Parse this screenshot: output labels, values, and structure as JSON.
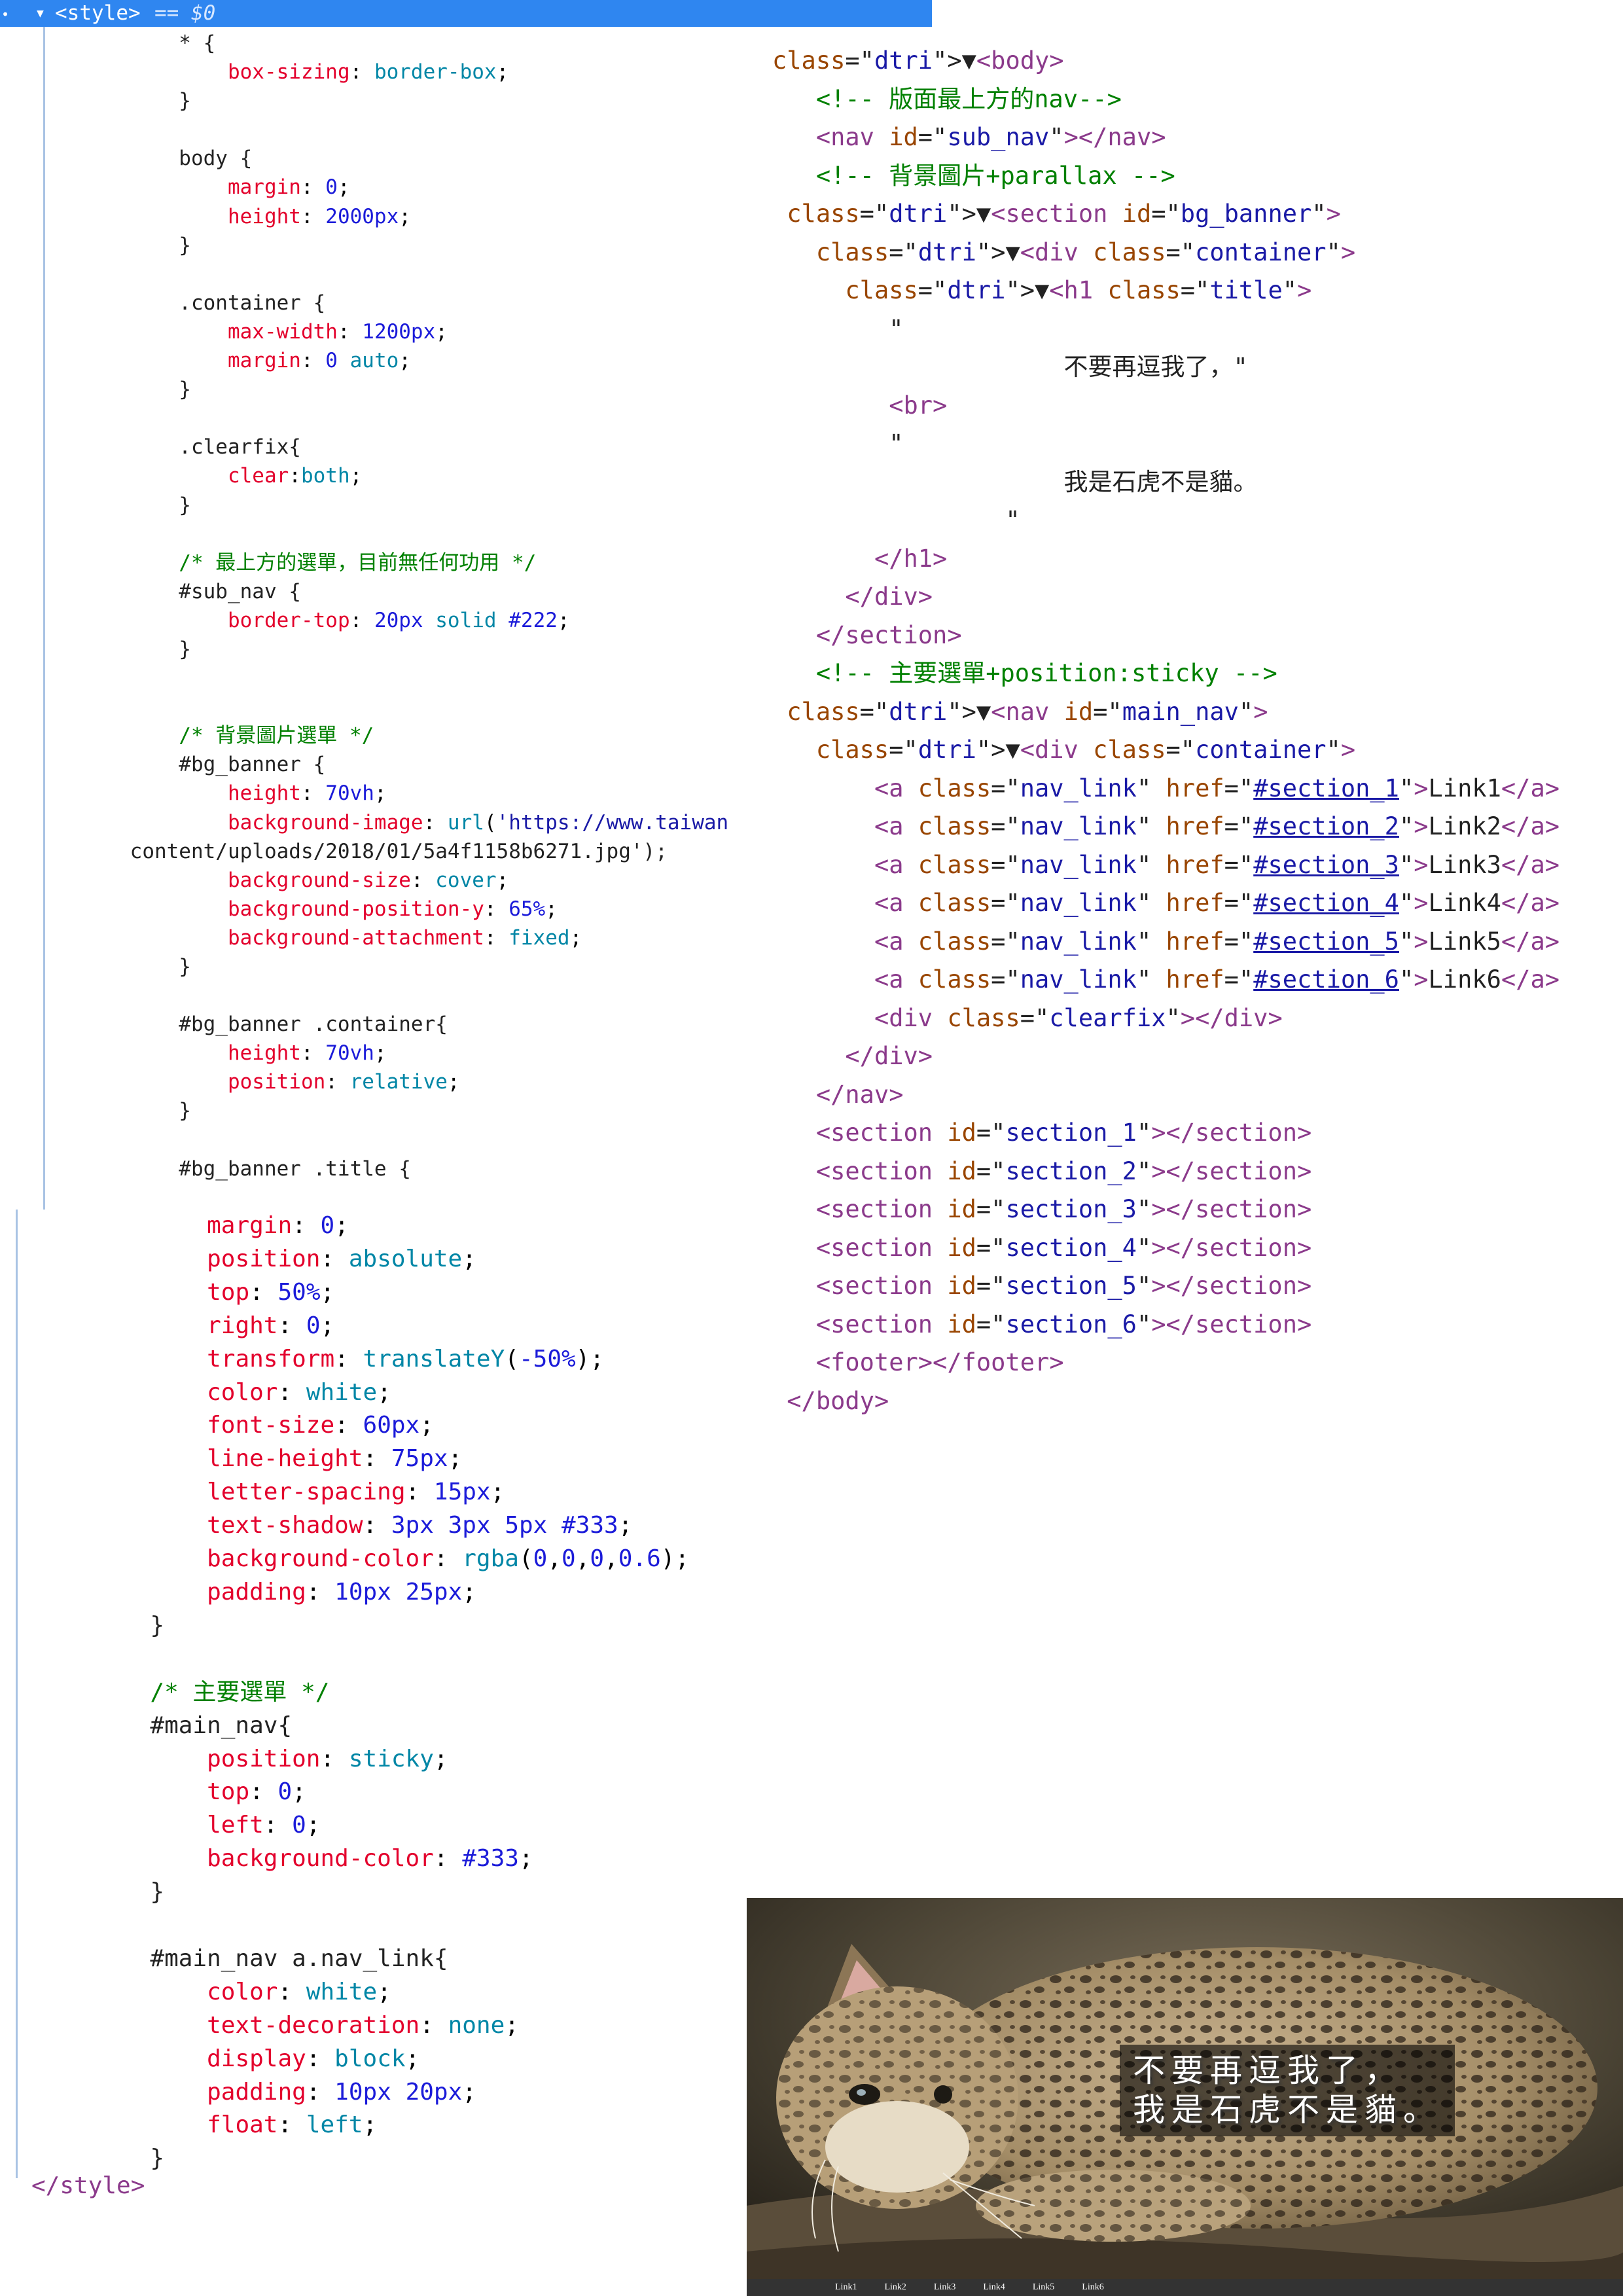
{
  "devtools_header": {
    "dot": "•",
    "expand_arrow": "▼",
    "tag_label": "<style>",
    "eq_label": "== $0"
  },
  "css_code": {
    "part1": "        * {\n            box-sizing: border-box;\n        }\n\n        body {\n            margin: 0;\n            height: 2000px;\n        }\n\n        .container {\n            max-width: 1200px;\n            margin: 0 auto;\n        }\n\n        .clearfix{\n            clear:both;\n        }\n\n        /* 最上方的選單，目前無任何功用 */\n        #sub_nav {\n            border-top: 20px solid #222;\n        }\n\n\n        /* 背景圖片選單 */\n        #bg_banner {\n            height: 70vh;\n            background-image: url('https://www.taiwan\n    content/uploads/2018/01/5a4f1158b6271.jpg');\n            background-size: cover;\n            background-position-y: 65%;\n            background-attachment: fixed;\n        }\n\n        #bg_banner .container{\n            height: 70vh;\n            position: relative;\n        }\n\n        #bg_banner .title {",
    "part2": "            margin: 0;\n            position: absolute;\n            top: 50%;\n            right: 0;\n            transform: translateY(-50%);\n            color: white;\n            font-size: 60px;\n            line-height: 75px;\n            letter-spacing: 15px;\n            text-shadow: 3px 3px 5px #333;\n            background-color: rgba(0,0,0,0.6);\n            padding: 10px 25px;\n        }\n\n        /* 主要選單 */\n        #main_nav{\n            position: sticky;\n            top: 0;\n            left: 0;\n            background-color: #333;\n        }\n\n        #main_nav a.nav_link{\n            color: white;\n            text-decoration: none;\n            display: block;\n            padding: 10px 20px;\n            float: left;\n        }\n",
    "closing_tag": "</style>"
  },
  "dom_tree": [
    "▼<body>",
    "   <!-- 版面最上方的nav-->",
    "   <nav id=\"sub_nav\"></nav>",
    "   <!-- 背景圖片+parallax -->",
    " ▼<section id=\"bg_banner\">",
    "   ▼<div class=\"container\">",
    "     ▼<h1 class=\"title\">",
    "        \"",
    "                    不要再逗我了，\"",
    "        <br>",
    "        \"",
    "                    我是石虎不是貓。",
    "                \"",
    "       </h1>",
    "     </div>",
    "   </section>",
    "   <!-- 主要選單+position:sticky -->",
    " ▼<nav id=\"main_nav\">",
    "   ▼<div class=\"container\">",
    "       <a class=\"nav_link\" href=\"#section_1\">Link1</a>",
    "       <a class=\"nav_link\" href=\"#section_2\">Link2</a>",
    "       <a class=\"nav_link\" href=\"#section_3\">Link3</a>",
    "       <a class=\"nav_link\" href=\"#section_4\">Link4</a>",
    "       <a class=\"nav_link\" href=\"#section_5\">Link5</a>",
    "       <a class=\"nav_link\" href=\"#section_6\">Link6</a>",
    "       <div class=\"clearfix\"></div>",
    "     </div>",
    "   </nav>",
    "   <section id=\"section_1\"></section>",
    "   <section id=\"section_2\"></section>",
    "   <section id=\"section_3\"></section>",
    "   <section id=\"section_4\"></section>",
    "   <section id=\"section_5\"></section>",
    "   <section id=\"section_6\"></section>",
    "   <footer></footer>",
    " </body>"
  ],
  "preview": {
    "title_line1": "不要再逗我了，",
    "title_line2": "我是石虎不是貓。",
    "nav_links": [
      "Link1",
      "Link2",
      "Link3",
      "Link4",
      "Link5",
      "Link6"
    ],
    "nav_background": "#333333",
    "title_background": "rgba(0,0,0,0.6)"
  }
}
